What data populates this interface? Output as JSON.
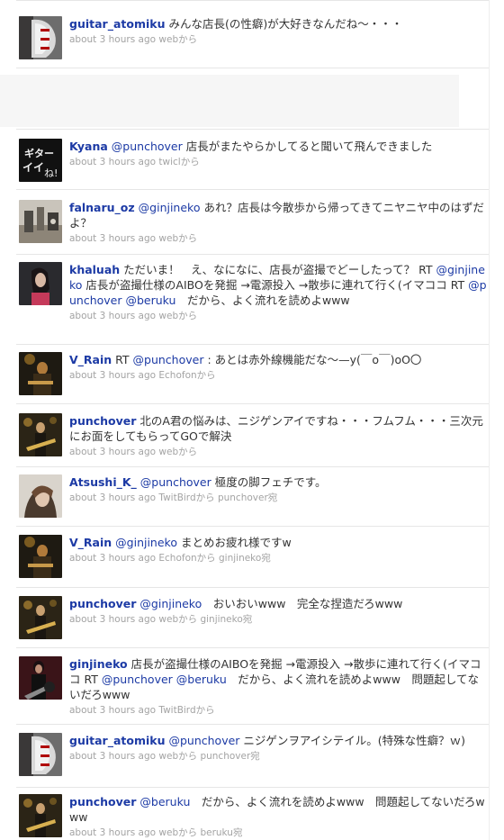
{
  "tweets": [
    {
      "user": "guitar_atomiku",
      "before": "",
      "mention1": "",
      "text": "みんな店長(の性癖)が大好きなんだね〜・・・",
      "mention2": "",
      "mention3": "",
      "tail": "",
      "time": "about 3 hours ago",
      "source": "webから",
      "reply": "",
      "avatar_icon": "strat-guitar-icon"
    },
    {
      "user": "Kyana",
      "before": "",
      "mention1": "@punchover",
      "text": " 店長がまたやらかしてると聞いて飛んできました",
      "mention2": "",
      "mention3": "",
      "tail": "",
      "time": "about 3 hours ago",
      "source": "twiclから",
      "reply": "",
      "avatar_icon": "calligraphy-icon"
    },
    {
      "user": "falnaru_oz",
      "before": "",
      "mention1": "@ginjineko",
      "text": " あれ？店長は今散歩から帰ってきてニヤニヤ中のはずだよ？",
      "mention2": "",
      "mention3": "",
      "tail": "",
      "time": "about 3 hours ago",
      "source": "webから",
      "reply": "",
      "avatar_icon": "equipment-photo-icon"
    },
    {
      "user": "khaluah",
      "before": " ただいま！　え、なになに、店長が盗撮でどーしたって？ RT ",
      "mention1": "@ginjineko",
      "text": " 店長が盗撮仕様のAIBOを発掘 →電源投入 →散歩に連れて行く(イマココ RT ",
      "mention2": "@punchover",
      "mention3": "@beruku",
      "tail": "　だから、よく流れを読めよwww",
      "time": "about 3 hours ago",
      "source": "webから",
      "reply": "",
      "avatar_icon": "person-photo-icon"
    },
    {
      "user": "V_Rain",
      "before": " RT ",
      "mention1": "@punchover",
      "text": " : あとは赤外線機能だな〜—y(￣o￣)oO〇",
      "mention2": "",
      "mention3": "",
      "tail": "",
      "time": "about 3 hours ago",
      "source": "Echofonから",
      "reply": "",
      "avatar_icon": "stage-photo-icon"
    },
    {
      "user": "punchover",
      "before": "",
      "mention1": "",
      "text": " 北のA君の悩みは、ニジゲンアイですね・・・フムフム・・・三次元にお面をしてもらってGOで解決",
      "mention2": "",
      "mention3": "",
      "tail": "",
      "time": "about 3 hours ago",
      "source": "webから",
      "reply": "",
      "avatar_icon": "guitarist-photo-icon"
    },
    {
      "user": "Atsushi_K_",
      "before": "",
      "mention1": "@punchover",
      "text": " 極度の脚フェチです。",
      "mention2": "",
      "mention3": "",
      "tail": "",
      "time": "about 3 hours ago",
      "source": "TwitBirdから",
      "reply": "punchover宛",
      "avatar_icon": "portrait-photo-icon"
    },
    {
      "user": "V_Rain",
      "before": "",
      "mention1": "@ginjineko",
      "text": " まとめお疲れ様ですw",
      "mention2": "",
      "mention3": "",
      "tail": "",
      "time": "about 3 hours ago",
      "source": "Echofonから",
      "reply": "ginjineko宛",
      "avatar_icon": "stage-photo-icon"
    },
    {
      "user": "punchover",
      "before": "",
      "mention1": "@ginjineko",
      "text": "　おいおいwww　完全な捏造だろwww",
      "mention2": "",
      "mention3": "",
      "tail": "",
      "time": "about 3 hours ago",
      "source": "webから",
      "reply": "ginjineko宛",
      "avatar_icon": "guitarist-photo-icon"
    },
    {
      "user": "ginjineko",
      "before": "",
      "mention1": "",
      "text": " 店長が盗撮仕様のAIBOを発掘 →電源投入 →散歩に連れて行く(イマココ RT ",
      "mention2": "@punchover",
      "mention3": "@beruku",
      "tail": "　だから、よく流れを読めよwww　問題起してないだろwww",
      "time": "about 3 hours ago",
      "source": "TwitBirdから",
      "reply": "",
      "avatar_icon": "guitar-player-photo-icon"
    },
    {
      "user": "guitar_atomiku",
      "before": "",
      "mention1": "@punchover",
      "text": " ニジゲンヲアイシテイル。(特殊な性癖？ｗ)",
      "mention2": "",
      "mention3": "",
      "tail": "",
      "time": "about 3 hours ago",
      "source": "webから",
      "reply": "punchover宛",
      "avatar_icon": "strat-guitar-icon"
    },
    {
      "user": "punchover",
      "before": "",
      "mention1": "@beruku",
      "text": "　だから、よく流れを読めよwww　問題起してないだろwww",
      "mention2": "",
      "mention3": "",
      "tail": "",
      "time": "about 3 hours ago",
      "source": "webから",
      "reply": "beruku宛",
      "avatar_icon": "guitarist-photo-icon"
    }
  ],
  "colors": {
    "link": "#1c3aa5",
    "text": "#333333",
    "meta": "#a3a3a3",
    "divider": "#e6e6e6",
    "promo_background": "#f6f6f6"
  }
}
